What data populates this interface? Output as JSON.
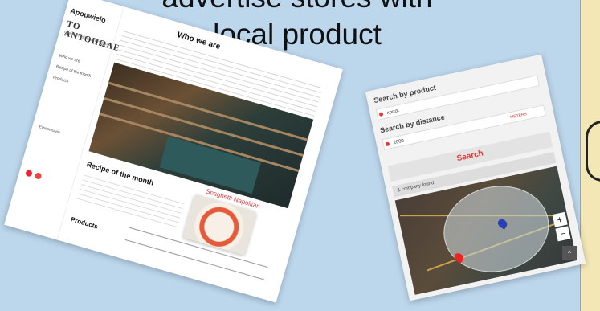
{
  "slide": {
    "title": "advertise stores with local product"
  },
  "left_mockup": {
    "logo_small": "Apopwielo",
    "logo_main": "ΤΟ ΑΝΤΟΠΩΛΕΙΟ",
    "logo_sub": "Greek Traditional Products",
    "nav": [
      "Who we are",
      "Recipe of the month",
      "Products"
    ],
    "contact_heading": "Επικοινωνία",
    "who_title": "Who we are",
    "recipe_title": "Recipe of the month",
    "recipe_name": "Spaghetti Napolitan",
    "products_title": "Products"
  },
  "right_mockup": {
    "search_by_product": "Search by product",
    "product_value": "κρασι",
    "search_by_distance": "Search by distance",
    "distance_value": "2000",
    "distance_unit": "METERS",
    "search_button": "Search",
    "found_text": "1 company found",
    "zoom_in": "+",
    "zoom_out": "−",
    "scroll_top": "^"
  }
}
